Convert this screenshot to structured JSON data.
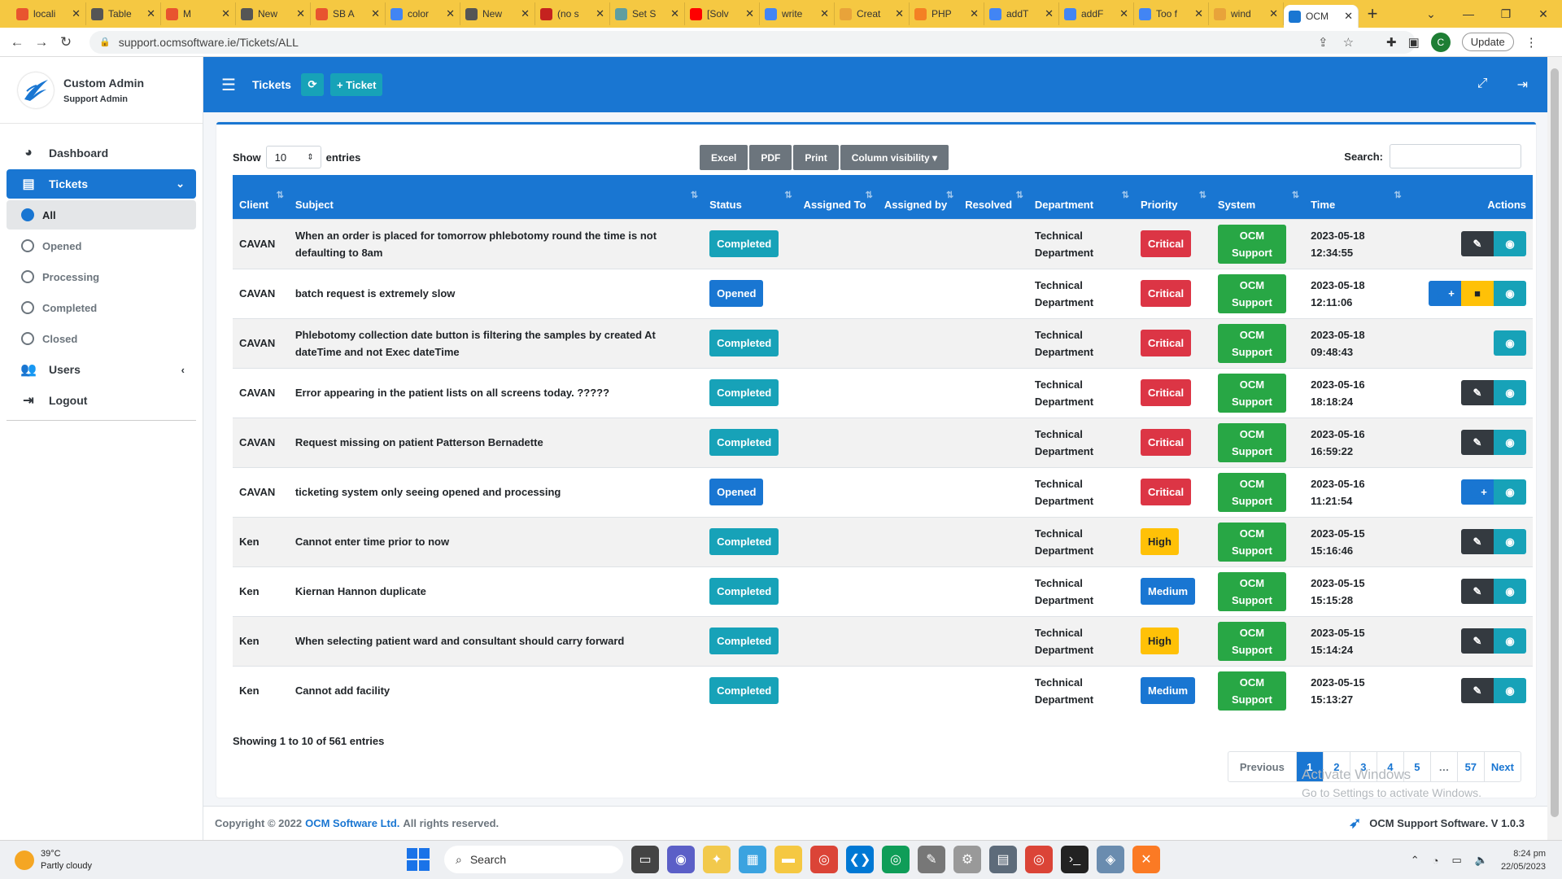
{
  "browser": {
    "tabs": [
      {
        "label": "locali",
        "color": "#e8542f"
      },
      {
        "label": "Table",
        "color": "#555"
      },
      {
        "label": "M",
        "color": "#e8542f"
      },
      {
        "label": "New",
        "color": "#555"
      },
      {
        "label": "SB A",
        "color": "#e8542f"
      },
      {
        "label": "color",
        "color": "#4285f4"
      },
      {
        "label": "New",
        "color": "#555"
      },
      {
        "label": "(no s",
        "color": "#c5221f"
      },
      {
        "label": "Set S",
        "color": "#5f9ea0"
      },
      {
        "label": "[Solv",
        "color": "#ff0000"
      },
      {
        "label": "write",
        "color": "#4285f4"
      },
      {
        "label": "Creat",
        "color": "#e8a33a"
      },
      {
        "label": "PHP",
        "color": "#f48024"
      },
      {
        "label": "addT",
        "color": "#4285f4"
      },
      {
        "label": "addF",
        "color": "#4285f4"
      },
      {
        "label": "Too f",
        "color": "#4285f4"
      },
      {
        "label": "wind",
        "color": "#e8a33a"
      },
      {
        "label": "OCM",
        "color": "#1976d2"
      }
    ],
    "url": "support.ocmsoftware.ie/Tickets/ALL",
    "update_label": "Update",
    "profile_initial": "C"
  },
  "sidebar": {
    "brand_name": "Custom Admin",
    "brand_role": "Support Admin",
    "items": [
      {
        "label": "Dashboard"
      },
      {
        "label": "Tickets"
      },
      {
        "label": "Users"
      },
      {
        "label": "Logout"
      }
    ],
    "ticket_subs": [
      {
        "label": "All"
      },
      {
        "label": "Opened"
      },
      {
        "label": "Processing"
      },
      {
        "label": "Completed"
      },
      {
        "label": "Closed"
      }
    ]
  },
  "header": {
    "title": "Tickets",
    "new_ticket_label": "+ Ticket"
  },
  "table_controls": {
    "show_label": "Show",
    "entries_value": "10",
    "entries_label": "entries",
    "buttons": [
      "Excel",
      "PDF",
      "Print",
      "Column visibility ▾"
    ],
    "search_label": "Search:"
  },
  "table": {
    "columns": [
      "Client",
      "Subject",
      "Status",
      "Assigned To",
      "Assigned by",
      "Resolved",
      "Department",
      "Priority",
      "System",
      "Time",
      "Actions"
    ],
    "rows": [
      {
        "client": "CAVAN",
        "subject": "When an order is placed for tomorrow phlebotomy round the time is not defaulting to 8am",
        "status": "Completed",
        "department": "Technical Department",
        "priority": "Critical",
        "system": "OCM Support",
        "time": "2023-05-18 12:34:55"
      },
      {
        "client": "CAVAN",
        "subject": "batch request is extremely slow",
        "status": "Opened",
        "department": "Technical Department",
        "priority": "Critical",
        "system": "OCM Support",
        "time": "2023-05-18 12:11:06"
      },
      {
        "client": "CAVAN",
        "subject": "Phlebotomy collection date button is filtering the samples by created At dateTime and not Exec dateTime",
        "status": "Completed",
        "department": "Technical Department",
        "priority": "Critical",
        "system": "OCM Support",
        "time": "2023-05-18 09:48:43"
      },
      {
        "client": "CAVAN",
        "subject": "Error appearing in the patient lists on all screens today. ?????",
        "status": "Completed",
        "department": "Technical Department",
        "priority": "Critical",
        "system": "OCM Support",
        "time": "2023-05-16 18:18:24"
      },
      {
        "client": "CAVAN",
        "subject": "Request missing on patient Patterson Bernadette",
        "status": "Completed",
        "department": "Technical Department",
        "priority": "Critical",
        "system": "OCM Support",
        "time": "2023-05-16 16:59:22"
      },
      {
        "client": "CAVAN",
        "subject": "ticketing system only seeing opened and processing",
        "status": "Opened",
        "department": "Technical Department",
        "priority": "Critical",
        "system": "OCM Support",
        "time": "2023-05-16 11:21:54"
      },
      {
        "client": "Ken",
        "subject": "Cannot enter time prior to now",
        "status": "Completed",
        "department": "Technical Department",
        "priority": "High",
        "system": "OCM Support",
        "time": "2023-05-15 15:16:46"
      },
      {
        "client": "Ken",
        "subject": "Kiernan Hannon duplicate",
        "status": "Completed",
        "department": "Technical Department",
        "priority": "Medium",
        "system": "OCM Support",
        "time": "2023-05-15 15:15:28"
      },
      {
        "client": "Ken",
        "subject": "When selecting patient ward and consultant should carry forward",
        "status": "Completed",
        "department": "Technical Department",
        "priority": "High",
        "system": "OCM Support",
        "time": "2023-05-15 15:14:24"
      },
      {
        "client": "Ken",
        "subject": "Cannot add facility",
        "status": "Completed",
        "department": "Technical Department",
        "priority": "Medium",
        "system": "OCM Support",
        "time": "2023-05-15 15:13:27"
      }
    ]
  },
  "showing_text": "Showing 1 to 10 of 561 entries",
  "pagination": [
    "Previous",
    "1",
    "2",
    "3",
    "4",
    "5",
    "…",
    "57",
    "Next"
  ],
  "watermark": {
    "title": "Activate Windows",
    "sub": "Go to Settings to activate Windows."
  },
  "footer": {
    "copyright_prefix": "Copyright © 2022",
    "company": "OCM Software Ltd.",
    "rights": "All rights reserved.",
    "version": "OCM Support Software. V 1.0.3"
  },
  "taskbar": {
    "temp": "39°C",
    "weather": "Partly cloudy",
    "search": "Search",
    "time": "8:24 pm",
    "date": "22/05/2023"
  },
  "colors": {
    "primary": "#1976d2",
    "info": "#17a2b8",
    "danger": "#dc3545",
    "warning": "#ffc107",
    "success": "#28a745",
    "dark": "#343a40"
  }
}
